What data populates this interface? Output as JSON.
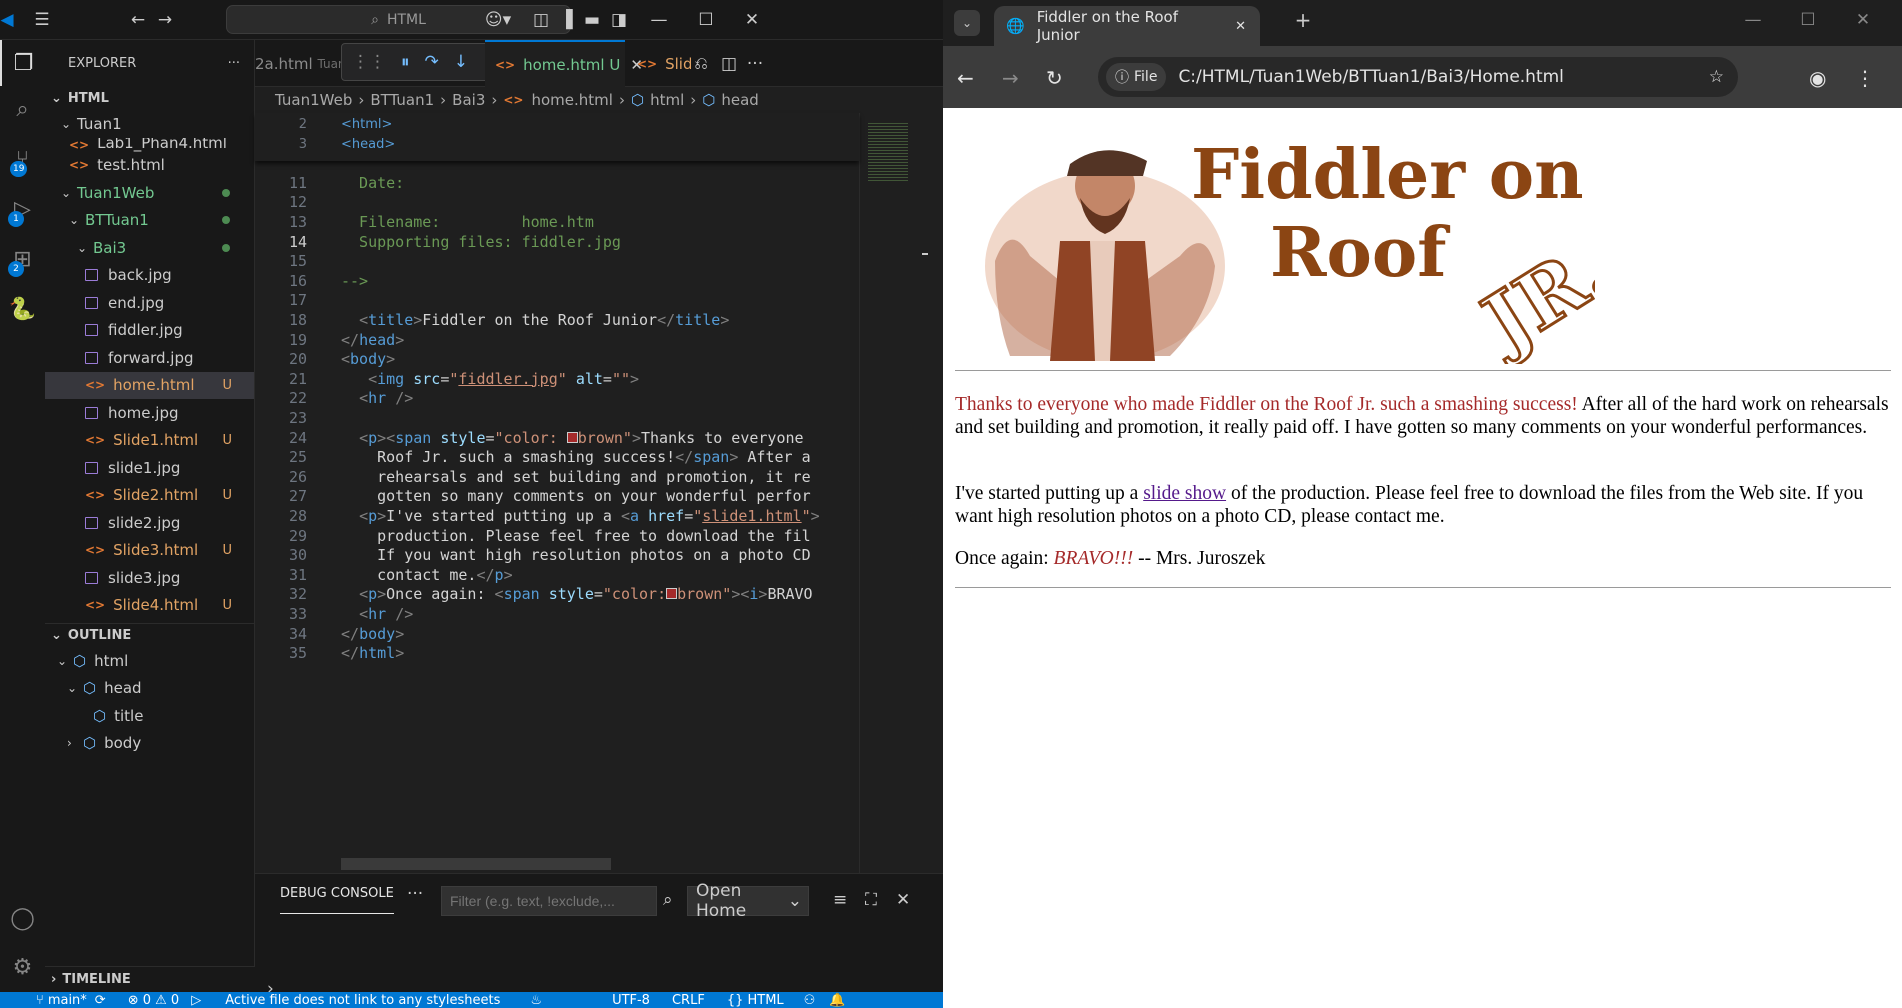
{
  "vscode": {
    "command_center": "HTML",
    "explorer": {
      "header": "EXPLORER",
      "section_html": "HTML",
      "tree": [
        {
          "label": "Tuan1",
          "kind": "folder",
          "level": 1,
          "open": true
        },
        {
          "label": "Lab1_Phan4.html",
          "kind": "html",
          "level": 2
        },
        {
          "label": "test.html",
          "kind": "html",
          "level": 2
        },
        {
          "label": "Tuan1Web",
          "kind": "folder",
          "level": 1,
          "open": true,
          "dot": true
        },
        {
          "label": "BTTuan1",
          "kind": "folder",
          "level": 2,
          "open": true,
          "dot": true
        },
        {
          "label": "Bai3",
          "kind": "folder",
          "level": 3,
          "open": true,
          "dot": true
        },
        {
          "label": "back.jpg",
          "kind": "img",
          "level": 4
        },
        {
          "label": "end.jpg",
          "kind": "img",
          "level": 4
        },
        {
          "label": "fiddler.jpg",
          "kind": "img",
          "level": 4
        },
        {
          "label": "forward.jpg",
          "kind": "img",
          "level": 4
        },
        {
          "label": "home.html",
          "kind": "html",
          "level": 4,
          "status": "U",
          "selected": true
        },
        {
          "label": "home.jpg",
          "kind": "img",
          "level": 4
        },
        {
          "label": "Slide1.html",
          "kind": "html",
          "level": 4,
          "status": "U"
        },
        {
          "label": "slide1.jpg",
          "kind": "img",
          "level": 4
        },
        {
          "label": "Slide2.html",
          "kind": "html",
          "level": 4,
          "status": "U"
        },
        {
          "label": "slide2.jpg",
          "kind": "img",
          "level": 4
        },
        {
          "label": "Slide3.html",
          "kind": "html",
          "level": 4,
          "status": "U"
        },
        {
          "label": "slide3.jpg",
          "kind": "img",
          "level": 4
        },
        {
          "label": "Slide4.html",
          "kind": "html",
          "level": 4,
          "status": "U"
        }
      ],
      "outline_header": "OUTLINE",
      "outline": [
        {
          "label": "html",
          "level": 1,
          "chev": "v"
        },
        {
          "label": "head",
          "level": 2,
          "chev": "v"
        },
        {
          "label": "title",
          "level": 3,
          "chev": ""
        },
        {
          "label": "body",
          "level": 2,
          "chev": ">"
        }
      ],
      "timeline": "TIMELINE"
    },
    "badges": {
      "source_control": "19",
      "run_debug": "1",
      "extensions": "2"
    },
    "tabs": {
      "prev": "2a.html",
      "prev_dir": "Tuan",
      "active": "home.html",
      "active_status": "U",
      "next": "Slide"
    },
    "breadcrumb": [
      "Tuan1Web",
      "BTTuan1",
      "Bai3",
      "home.html",
      "html",
      "head"
    ],
    "sticky": [
      {
        "n": "2",
        "html": "<span class='tg'>&lt;html&gt;</span>"
      },
      {
        "n": "3",
        "html": "<span class='tg'>&lt;head&gt;</span>"
      }
    ],
    "code": [
      {
        "n": "11",
        "html": "<span class='cm'>  Date:</span>"
      },
      {
        "n": "12",
        "html": ""
      },
      {
        "n": "13",
        "html": "<span class='cm'>  Filename:         home.htm</span>"
      },
      {
        "n": "14",
        "html": "<span class='cm'>  Supporting files: fiddler.jpg</span>",
        "cur": true
      },
      {
        "n": "15",
        "html": ""
      },
      {
        "n": "16",
        "html": "<span class='cm'>--&gt;</span>"
      },
      {
        "n": "17",
        "html": ""
      },
      {
        "n": "18",
        "html": "  <span class='br'>&lt;</span><span class='tg'>title</span><span class='br'>&gt;</span><span class='tx'>Fiddler on the Roof Junior</span><span class='br'>&lt;/</span><span class='tg'>title</span><span class='br'>&gt;</span>"
      },
      {
        "n": "19",
        "html": "<span class='br'>&lt;/</span><span class='tg'>head</span><span class='br'>&gt;</span>"
      },
      {
        "n": "20",
        "html": "<span class='br'>&lt;</span><span class='tg'>body</span><span class='br'>&gt;</span>"
      },
      {
        "n": "21",
        "html": "   <span class='br'>&lt;</span><span class='tg'>img</span> <span class='at'>src</span>=<span class='sv'>\"<u>fiddler.jpg</u>\"</span> <span class='at'>alt</span>=<span class='sv'>\"\"</span><span class='br'>&gt;</span>"
      },
      {
        "n": "22",
        "html": "  <span class='br'>&lt;</span><span class='tg'>hr</span> <span class='br'>/&gt;</span>"
      },
      {
        "n": "23",
        "html": ""
      },
      {
        "n": "24",
        "html": "  <span class='br'>&lt;</span><span class='tg'>p</span><span class='br'>&gt;&lt;</span><span class='tg'>span</span> <span class='at'>style</span>=<span class='sv'>\"color: <span style='display:inline-block;width:11px;height:11px;background:#a52a2a;border:1px solid #ccc'></span>brown\"</span><span class='br'>&gt;</span><span class='tx'>Thanks to everyone</span>"
      },
      {
        "n": "25",
        "html": "    <span class='tx'>Roof Jr. such a smashing success!</span><span class='br'>&lt;/</span><span class='tg'>span</span><span class='br'>&gt;</span><span class='tx'> After a</span>"
      },
      {
        "n": "26",
        "html": "    <span class='tx'>rehearsals and set building and promotion, it re</span>"
      },
      {
        "n": "27",
        "html": "    <span class='tx'>gotten so many comments on your wonderful perfor</span>"
      },
      {
        "n": "28",
        "html": "  <span class='br'>&lt;</span><span class='tg'>p</span><span class='br'>&gt;</span><span class='tx'>I've started putting up a </span><span class='br'>&lt;</span><span class='tg'>a</span> <span class='at'>href</span>=<span class='sv'>\"<u>slide1.html</u>\"</span><span class='br'>&gt;</span>"
      },
      {
        "n": "29",
        "html": "    <span class='tx'>production. Please feel free to download the fil</span>"
      },
      {
        "n": "30",
        "html": "    <span class='tx'>If you want high resolution photos on a photo CD</span>"
      },
      {
        "n": "31",
        "html": "    <span class='tx'>contact me.</span><span class='br'>&lt;/</span><span class='tg'>p</span><span class='br'>&gt;</span>"
      },
      {
        "n": "32",
        "html": "  <span class='br'>&lt;</span><span class='tg'>p</span><span class='br'>&gt;</span><span class='tx'>Once again: </span><span class='br'>&lt;</span><span class='tg'>span</span> <span class='at'>style</span>=<span class='sv'>\"color:<span style='display:inline-block;width:11px;height:11px;background:#a52a2a;border:1px solid #ccc'></span>brown\"</span><span class='br'>&gt;&lt;</span><span class='tg'>i</span><span class='br'>&gt;</span><span class='tx'>BRAVO</span>"
      },
      {
        "n": "33",
        "html": "  <span class='br'>&lt;</span><span class='tg'>hr</span> <span class='br'>/&gt;</span>"
      },
      {
        "n": "34",
        "html": "<span class='br'>&lt;/</span><span class='tg'>body</span><span class='br'>&gt;</span>"
      },
      {
        "n": "35",
        "html": "<span class='br'>&lt;/</span><span class='tg'>html</span><span class='br'>&gt;</span>"
      }
    ],
    "panel": {
      "tab": "DEBUG CONSOLE",
      "filter_placeholder": "Filter (e.g. text, !exclude,...",
      "select": "Open Home"
    },
    "status": {
      "branch": "main*",
      "problems": "⊗ 0 ⚠ 0",
      "message": "Active file does not link to any stylesheets",
      "encoding": "UTF-8",
      "eol": "CRLF",
      "lang": "{} HTML"
    }
  },
  "browser": {
    "tab_title": "Fiddler on the Roof Junior",
    "chip": "File",
    "url": "C:/HTML/Tuan1Web/BTTuan1/Bai3/Home.html",
    "banner_title_1": "Fiddler on the",
    "banner_title_2": "Roof",
    "banner_jr": "JR.",
    "p1_brown": "Thanks to everyone who made Fiddler on the Roof Jr. such a smashing success!",
    "p1_rest": " After all of the hard work on rehearsals and set building and promotion, it really paid off. I have gotten so many comments on your wonderful performances.",
    "p2_before": "I've started putting up a ",
    "p2_link": "slide show",
    "p2_after": " of the production. Please feel free to download the files from the Web site. If you want high resolution photos on a photo CD, please contact me.",
    "p3_before": "Once again: ",
    "p3_bravo": "BRAVO!!!",
    "p3_after": " -- Mrs. Juroszek"
  },
  "colors": {
    "accent": "#0078d4",
    "brown": "#a52a2a",
    "banner_brown": "#8b4513"
  }
}
